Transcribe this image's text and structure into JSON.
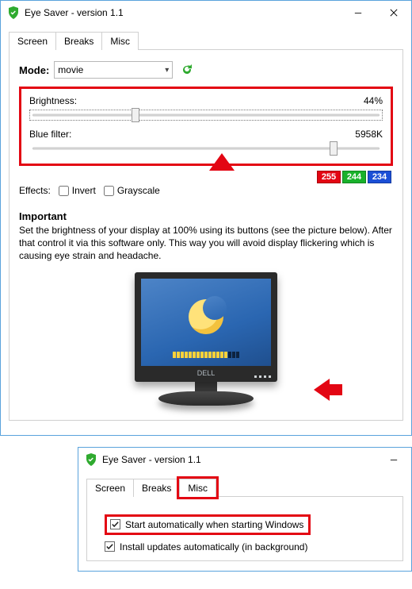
{
  "win1": {
    "title": "Eye Saver - version 1.1",
    "tabs": {
      "screen": "Screen",
      "breaks": "Breaks",
      "misc": "Misc"
    },
    "mode": {
      "label": "Mode:",
      "value": "movie"
    },
    "brightness": {
      "label": "Brightness:",
      "value": "44%",
      "percent": 30
    },
    "bluefilter": {
      "label": "Blue filter:",
      "value": "5958K",
      "percent": 86
    },
    "rgb": {
      "r": "255",
      "g": "244",
      "b": "234"
    },
    "effects": {
      "label": "Effects:",
      "invert": "Invert",
      "grayscale": "Grayscale"
    },
    "important": {
      "heading": "Important",
      "body": "Set the brightness of your display at 100% using its buttons (see the picture below). After that control it via this software only. This way you will avoid display flickering which is causing eye strain and headache."
    },
    "monitor_brand": "DELL"
  },
  "win2": {
    "title": "Eye Saver - version 1.1",
    "tabs": {
      "screen": "Screen",
      "breaks": "Breaks",
      "misc": "Misc"
    },
    "opt1": "Start automatically when starting Windows",
    "opt2": "Install updates automatically (in background)"
  },
  "colors": {
    "r": "#e30613",
    "g": "#19b22b",
    "b": "#1b4fd6"
  }
}
